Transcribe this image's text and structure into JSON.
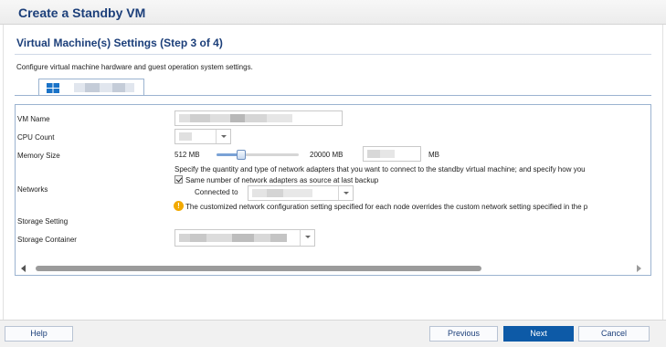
{
  "window": {
    "title": "Create a Standby VM"
  },
  "step": {
    "title": "Virtual Machine(s) Settings (Step 3 of 4)",
    "description": "Configure virtual machine hardware and guest operation system settings."
  },
  "tab": {
    "icon": "windows-icon",
    "label": ""
  },
  "settings": {
    "vm_name": {
      "label": "VM Name",
      "value": ""
    },
    "cpu_count": {
      "label": "CPU Count",
      "value": ""
    },
    "memory_size": {
      "label": "Memory Size",
      "min_label": "512 MB",
      "max_label": "20000 MB",
      "value": "",
      "unit": "MB",
      "slider_fraction": 0.3
    },
    "networks": {
      "label": "Networks",
      "description": "Specify the quantity and type of network adapters that you want to connect to the standby virtual machine; and specify how you",
      "same_number_label": "Same number of network adapters as source at last backup",
      "same_number_checked": true,
      "connected_to_label": "Connected to",
      "connected_to_value": "",
      "warning": "The customized network configuration setting specified for each node overrides the custom network setting specified in the p"
    },
    "storage_setting": {
      "label": "Storage Setting"
    },
    "storage_container": {
      "label": "Storage Container",
      "value": ""
    }
  },
  "footer": {
    "help_label": "Help",
    "previous_label": "Previous",
    "next_label": "Next",
    "cancel_label": "Cancel"
  },
  "colors": {
    "title": "#1c3f7a",
    "primary_button": "#0d5aa7",
    "panel_border": "#9bb3d0",
    "warning": "#f2a900"
  }
}
